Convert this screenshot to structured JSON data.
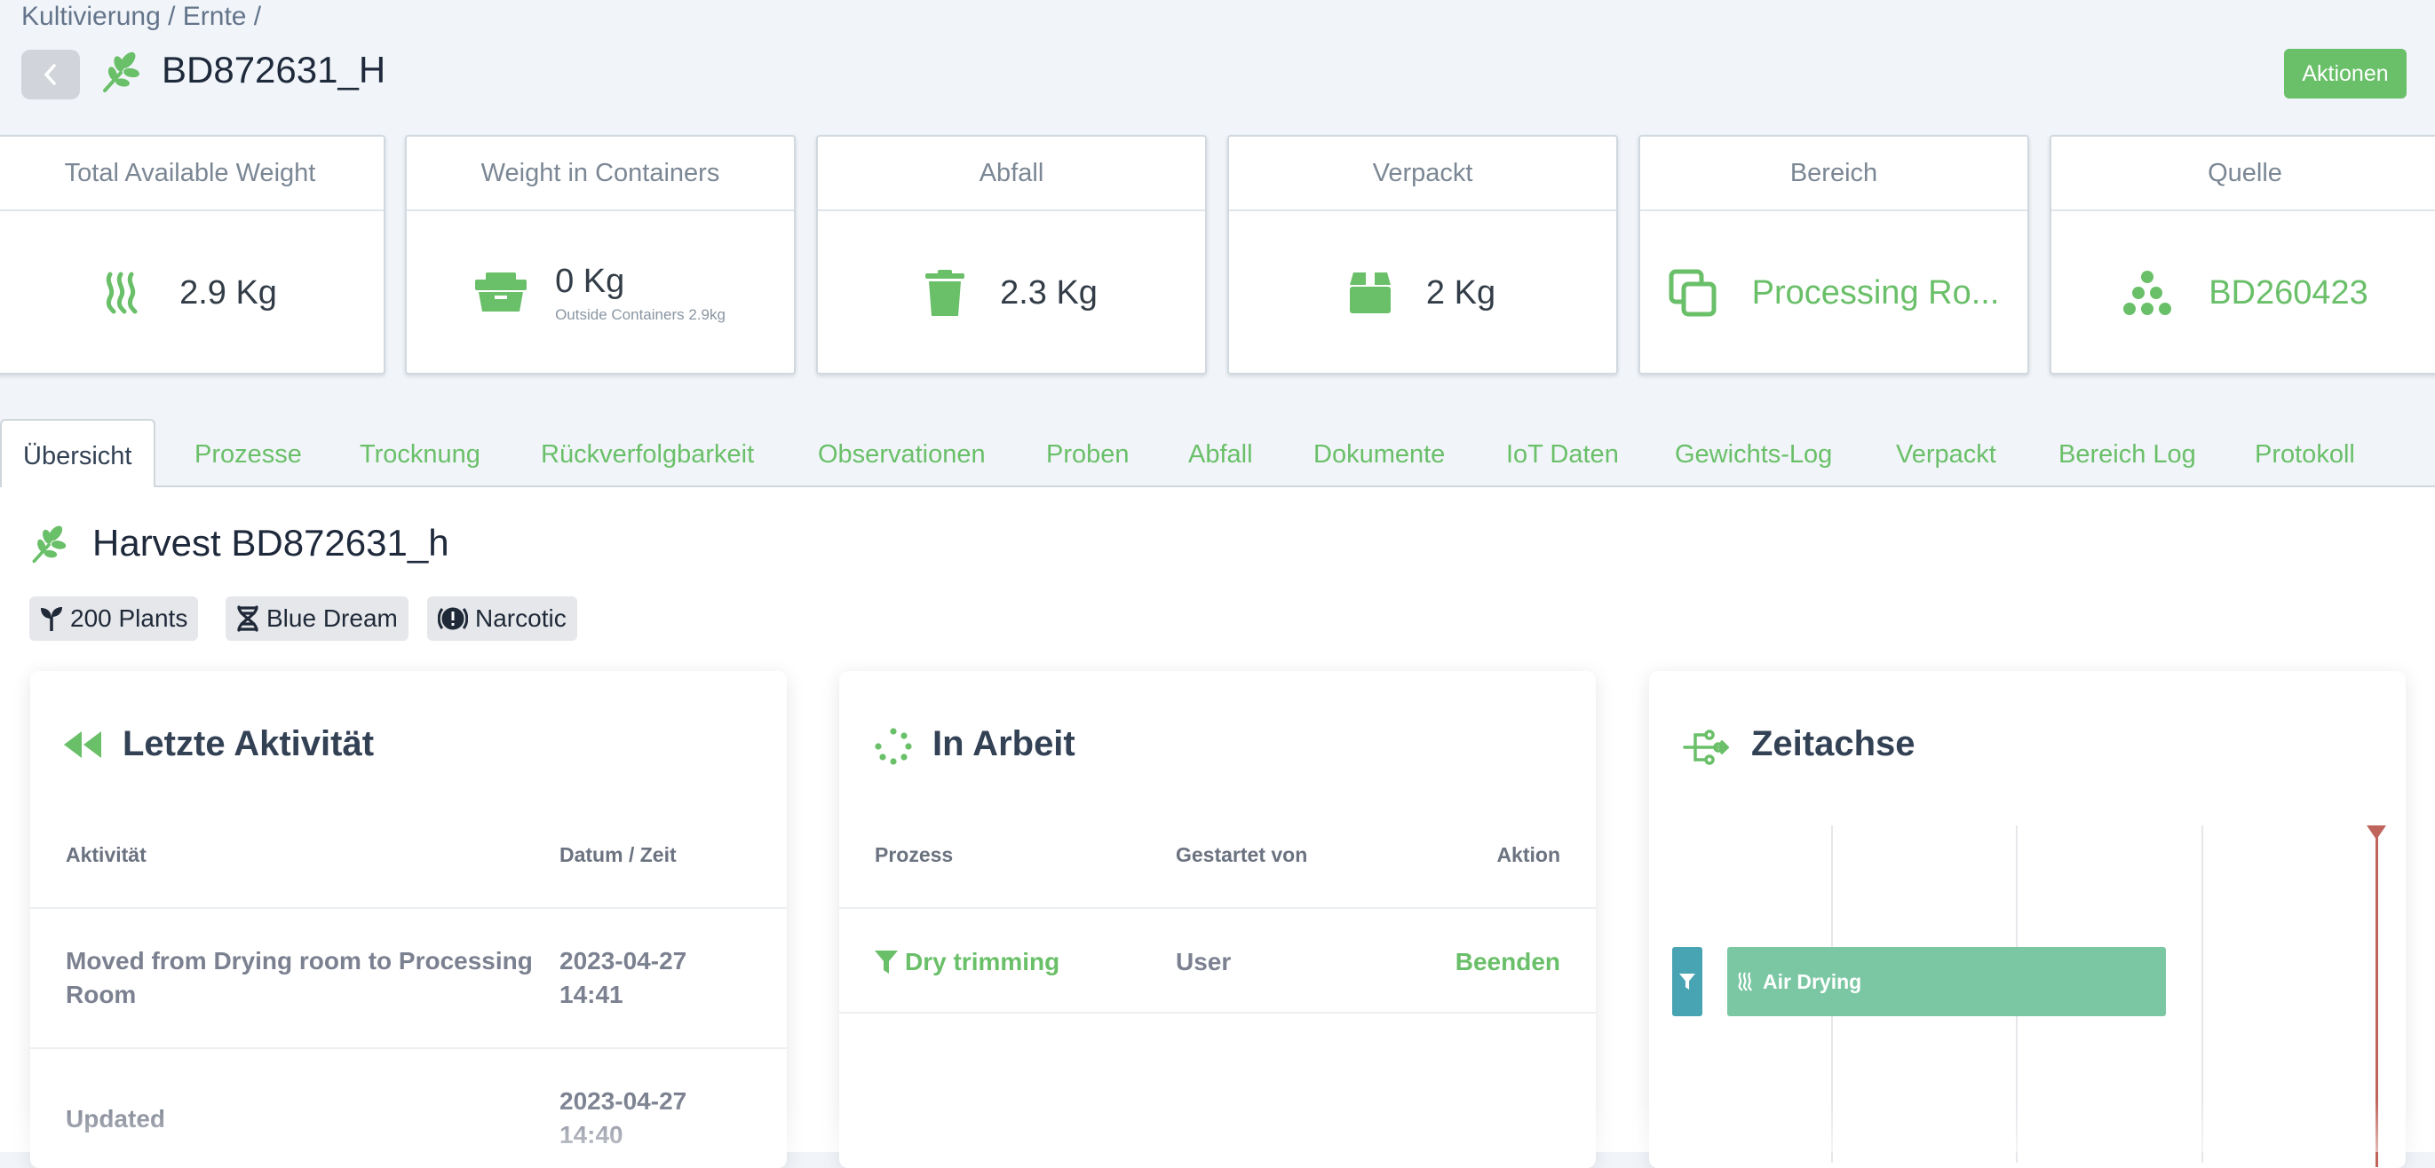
{
  "breadcrumb": "Kultivierung / Ernte /",
  "header": {
    "title": "BD872631_H",
    "actions_label": "Aktionen"
  },
  "cards": [
    {
      "title": "Total Available Weight",
      "value": "2.9 Kg",
      "icon": "heat-waves-icon"
    },
    {
      "title": "Weight in Containers",
      "value": "0 Kg",
      "sub": "Outside Containers 2.9kg",
      "icon": "container-icon"
    },
    {
      "title": "Abfall",
      "value": "2.3 Kg",
      "icon": "trash-icon"
    },
    {
      "title": "Verpackt",
      "value": "2 Kg",
      "icon": "package-icon"
    },
    {
      "title": "Bereich",
      "value": "Processing Ro...",
      "icon": "copy-squares-icon"
    },
    {
      "title": "Quelle",
      "value": "BD260423",
      "icon": "dots-pyramid-icon"
    }
  ],
  "tabs": [
    "Übersicht",
    "Prozesse",
    "Trocknung",
    "Rückverfolgbarkeit",
    "Observationen",
    "Proben",
    "Abfall",
    "Dokumente",
    "IoT Daten",
    "Gewichts-Log",
    "Verpackt",
    "Bereich Log",
    "Protokoll"
  ],
  "harvest": {
    "title": "Harvest BD872631_h",
    "chips": [
      {
        "label": "200 Plants",
        "icon": "seedling-icon"
      },
      {
        "label": "Blue Dream",
        "icon": "dna-icon"
      },
      {
        "label": "Narcotic",
        "icon": "warning-circle-icon"
      }
    ]
  },
  "activity": {
    "title": "Letzte Aktivität",
    "col_activity": "Aktivität",
    "col_datetime": "Datum / Zeit",
    "rows": [
      {
        "activity_1": "Moved from Drying room to Processing",
        "activity_2": "Room",
        "date": "2023-04-27",
        "time": "14:41"
      },
      {
        "activity_1": "Updated",
        "activity_2": "",
        "date": "2023-04-27",
        "time": "14:40"
      }
    ]
  },
  "in_progress": {
    "title": "In Arbeit",
    "col_process": "Prozess",
    "col_started_by": "Gestartet von",
    "col_action": "Aktion",
    "rows": [
      {
        "process": "Dry trimming",
        "started_by": "User",
        "action": "Beenden"
      }
    ]
  },
  "timeline": {
    "title": "Zeitachse",
    "bar_label": "Air Drying"
  },
  "colors": {
    "green": "#6abf69",
    "teal": "#48a3b3",
    "bar": "#7bc7a3",
    "now": "#c0655b"
  }
}
